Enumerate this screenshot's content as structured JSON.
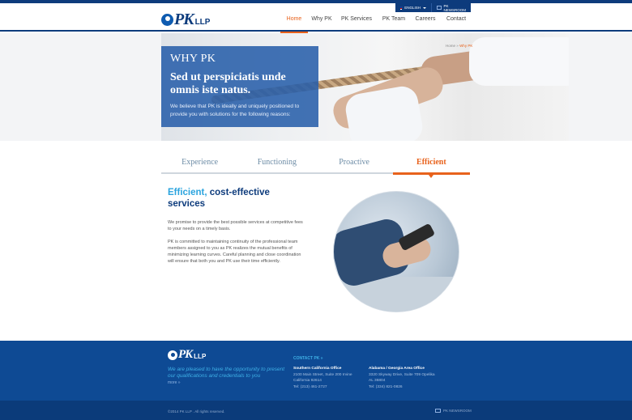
{
  "utility": {
    "language": "ENGLISH",
    "newsroom": "PK NEWSROOM"
  },
  "header": {
    "logo_text": "PK",
    "logo_suffix": "LLP",
    "nav": [
      {
        "label": "Home",
        "active": true
      },
      {
        "label": "Why PK",
        "active": false
      },
      {
        "label": "PK Services",
        "active": false
      },
      {
        "label": "PK Team",
        "active": false
      },
      {
        "label": "Careers",
        "active": false
      },
      {
        "label": "Contact",
        "active": false
      }
    ]
  },
  "hero": {
    "eyebrow": "WHY PK",
    "heading": "Sed ut perspiciatis unde omnis iste natus.",
    "text": "We believe that PK is ideally and uniquely positioned to provide you with solutions for the following reasons:",
    "breadcrumb": {
      "home": "Home",
      "separator": "»",
      "current": "Why PK"
    }
  },
  "tabs": [
    {
      "label": "Experience",
      "active": false
    },
    {
      "label": "Functioning",
      "active": false
    },
    {
      "label": "Proactive",
      "active": false
    },
    {
      "label": "Efficient",
      "active": true
    }
  ],
  "content": {
    "title_highlight": "Efficient,",
    "title_rest": "cost-effective services",
    "paragraph1": "We promise to provide the best possible services at competitive fees to your needs on a timely basis.",
    "paragraph2": "PK is committed to maintaining continuity of the professional team members assigned to you as PK realizes the mutual benefits of minimizing learning curves. Careful planning and close coordination will ensure that both you and PK use their time efficiently."
  },
  "footer": {
    "logo_text": "PK",
    "logo_suffix": "LLP",
    "tagline": "We are pleased to have the opportunity to present our qualifications and credentials to you",
    "more": "more »",
    "contact_label": "CONTACT PK »",
    "offices": [
      {
        "name": "Southern California Office",
        "line1": "2100 Main Street, Suite 200 Irvine",
        "line2": "California 92614",
        "phone": "Tel: (213) 461-2727"
      },
      {
        "name": "Alabama / Georgia Area Office",
        "line1": "3320 Skyway Drive, Suite 709 Opelika",
        "line2": "AL 36804",
        "phone": "Tel: (334) 821-0826"
      }
    ],
    "copyright": "©2014 PK LLP . All rights reserved.",
    "newsroom": "PK NEWSROOM"
  },
  "colors": {
    "brand_navy": "#0d3b7c",
    "accent_orange": "#e8621c",
    "accent_cyan": "#2ba4de",
    "footer_blue": "#0e4a94"
  }
}
